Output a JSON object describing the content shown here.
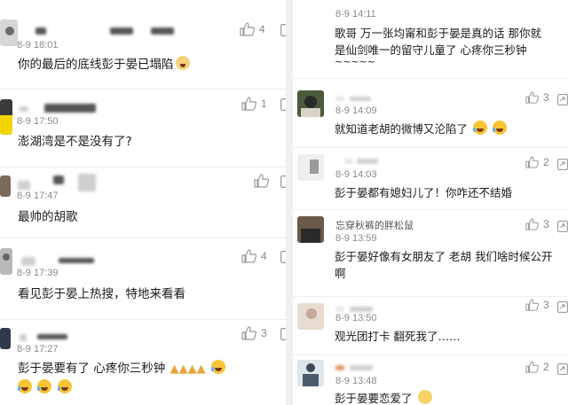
{
  "left_comments": [
    {
      "time": "8-9 18:01",
      "text": "你的最后的底线彭于晏已塌陷",
      "likes": "4",
      "emoji": "doge"
    },
    {
      "time": "8-9 17:50",
      "text": "澎湖湾是不是没有了?",
      "likes": "1"
    },
    {
      "time": "8-9 17:47",
      "text": "最帅的胡歌",
      "likes": ""
    },
    {
      "time": "8-9 17:39",
      "text": "看见彭于晏上热搜，特地来看看",
      "likes": "4"
    },
    {
      "time": "8-9 17:27",
      "text": "彭于晏要有了 心疼你三秒钟",
      "likes": "3",
      "emoji": "pray-x4-laugh"
    }
  ],
  "right_comments": [
    {
      "time": "8-9 14:11",
      "text_line1": "歌哥   万一张均甯和彭于晏是真的话  那你就",
      "text_line2": "是仙剑唯一的留守儿童了  心疼你三秒钟",
      "text_line3": "~~~~~"
    },
    {
      "time": "8-9 14:09",
      "text": "就知道老胡的微博又沦陷了",
      "likes": "3",
      "emoji": "laugh-cry"
    },
    {
      "time": "8-9 14:03",
      "text": "彭于晏都有媳妇儿了！你咋还不结婚",
      "likes": "2"
    },
    {
      "username": "忘穿秋裤的胖松鼠",
      "time": "8-9 13:59",
      "text_line1": "彭于晏好像有女朋友了 老胡 我们啥时候公开",
      "text_line2": "啊",
      "likes": "3"
    },
    {
      "time": "8-9 13:50",
      "text": "观光团打卡  翻死我了……",
      "likes": "3"
    },
    {
      "time": "8-9 13:48",
      "text": "彭于晏要恋爱了",
      "likes": "2",
      "emoji": "sad"
    }
  ],
  "icons": {
    "like": "thumbs-up-icon",
    "share": "share-icon"
  },
  "colors": {
    "background": "#ffffff",
    "divider": "#f0f0f0",
    "time_text": "#8a8a8a",
    "icon": "#9a9a9a",
    "emoji": "#f7c436"
  }
}
